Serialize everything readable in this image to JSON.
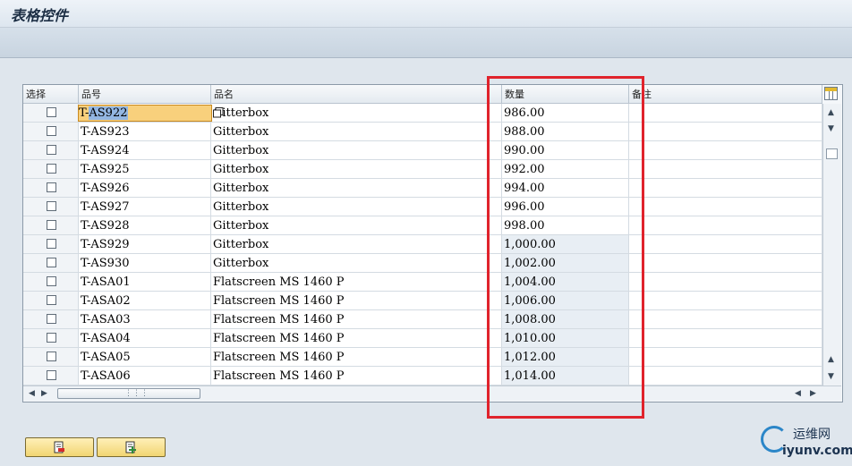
{
  "window": {
    "title": "表格控件"
  },
  "table": {
    "columns": [
      {
        "key": "select",
        "label": "选择"
      },
      {
        "key": "item_no",
        "label": "品号"
      },
      {
        "key": "item_name",
        "label": "品名"
      },
      {
        "key": "quantity",
        "label": "数量"
      },
      {
        "key": "remark",
        "label": "备注"
      }
    ],
    "focused_cell": {
      "prefix": "T-",
      "selected": "AS922"
    },
    "rows": [
      {
        "item_no": "T-AS922",
        "item_name": "Gitterbox",
        "quantity": "986.00"
      },
      {
        "item_no": "T-AS923",
        "item_name": "Gitterbox",
        "quantity": "988.00"
      },
      {
        "item_no": "T-AS924",
        "item_name": "Gitterbox",
        "quantity": "990.00"
      },
      {
        "item_no": "T-AS925",
        "item_name": "Gitterbox",
        "quantity": "992.00"
      },
      {
        "item_no": "T-AS926",
        "item_name": "Gitterbox",
        "quantity": "994.00"
      },
      {
        "item_no": "T-AS927",
        "item_name": "Gitterbox",
        "quantity": "996.00"
      },
      {
        "item_no": "T-AS928",
        "item_name": "Gitterbox",
        "quantity": "998.00"
      },
      {
        "item_no": "T-AS929",
        "item_name": "Gitterbox",
        "quantity": "1,000.00"
      },
      {
        "item_no": "T-AS930",
        "item_name": "Gitterbox",
        "quantity": "1,002.00"
      },
      {
        "item_no": "T-ASA01",
        "item_name": "Flatscreen MS 1460 P",
        "quantity": "1,004.00"
      },
      {
        "item_no": "T-ASA02",
        "item_name": "Flatscreen MS 1460 P",
        "quantity": "1,006.00"
      },
      {
        "item_no": "T-ASA03",
        "item_name": "Flatscreen MS 1460 P",
        "quantity": "1,008.00"
      },
      {
        "item_no": "T-ASA04",
        "item_name": "Flatscreen MS 1460 P",
        "quantity": "1,010.00"
      },
      {
        "item_no": "T-ASA05",
        "item_name": "Flatscreen MS 1460 P",
        "quantity": "1,012.00"
      },
      {
        "item_no": "T-ASA06",
        "item_name": "Flatscreen MS 1460 P",
        "quantity": "1,014.00"
      }
    ]
  },
  "buttons": [
    {
      "name": "delete-row-button",
      "icon": "delete-row-icon"
    },
    {
      "name": "insert-row-button",
      "icon": "insert-row-icon"
    }
  ],
  "watermark": {
    "cn": "运维网",
    "en": "iyunv.com"
  },
  "colors": {
    "highlight": "#e0232c",
    "focus": "#f8d07c",
    "button": "#f1d572"
  }
}
